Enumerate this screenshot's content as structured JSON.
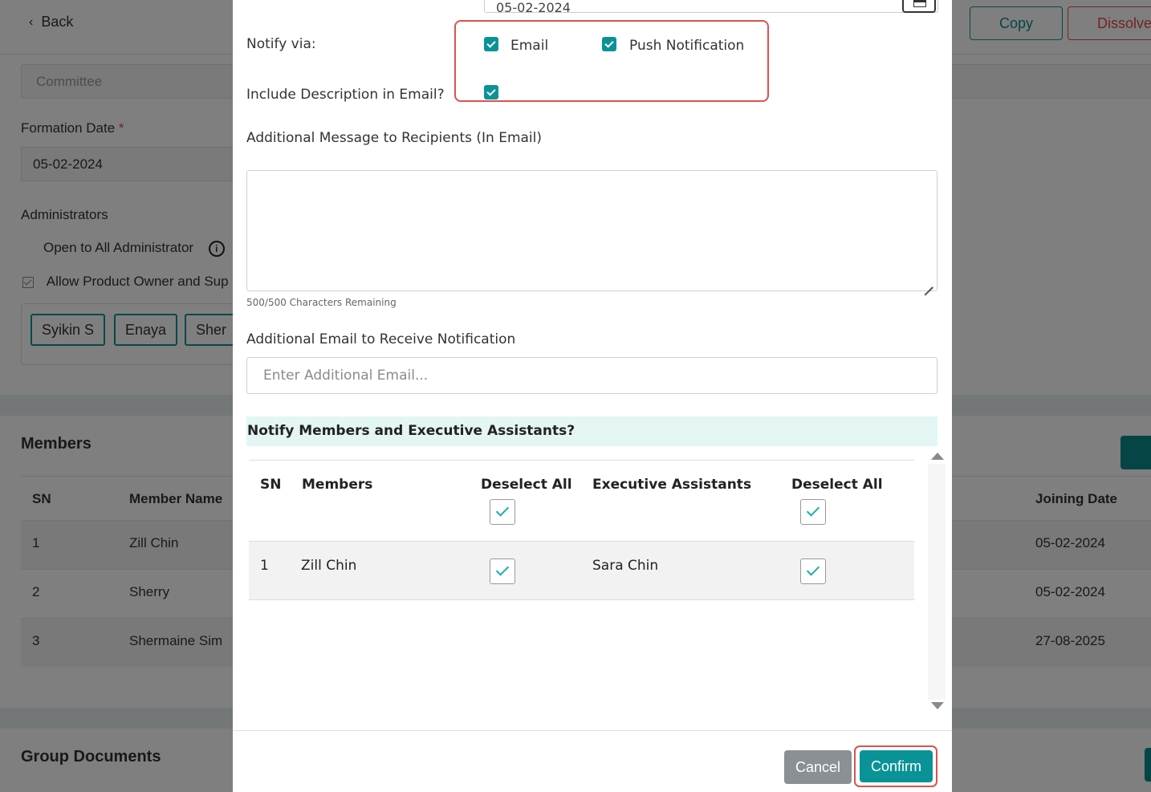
{
  "background": {
    "back_label": "Back",
    "copy_label": "Copy",
    "dissolve_label": "Dissolve",
    "committee_placeholder": "Committee",
    "formation_date_label": "Formation Date",
    "required_mark": "*",
    "formation_date_value": "05-02-2024",
    "administrators_label": "Administrators",
    "open_to_all_label": "Open to All Administrator",
    "allow_owner_label": "Allow Product Owner and Sup",
    "admin_chips": [
      "Syikin S",
      "Enaya",
      "Sher"
    ],
    "members_title": "Members",
    "members_columns": {
      "sn": "SN",
      "member_name": "Member Name",
      "joining_date": "Joining Date"
    },
    "members_rows": [
      {
        "sn": "1",
        "name": "Zill Chin",
        "joining": "05-02-2024"
      },
      {
        "sn": "2",
        "name": "Sherry",
        "joining": "05-02-2024"
      },
      {
        "sn": "3",
        "name": "Shermaine Sim",
        "joining": "27-08-2025"
      }
    ],
    "group_documents_title": "Group Documents"
  },
  "modal": {
    "date_value": "05-02-2024",
    "notify_via_label": "Notify via:",
    "email_label": "Email",
    "email_checked": true,
    "push_label": "Push Notification",
    "push_checked": true,
    "include_desc_label": "Include Description in Email?",
    "include_desc_checked": true,
    "additional_message_label": "Additional Message to Recipients (In Email)",
    "additional_message_value": "",
    "char_remaining": "500/500 Characters Remaining",
    "additional_email_label": "Additional Email to Receive Notification",
    "additional_email_placeholder": "Enter Additional Email...",
    "notify_members_title": "Notify Members and Executive Assistants?",
    "table": {
      "col_sn": "SN",
      "col_members": "Members",
      "col_deselect_members": "Deselect All",
      "col_exec": "Executive Assistants",
      "col_deselect_exec": "Deselect All",
      "rows": [
        {
          "sn": "1",
          "member": "Zill Chin",
          "member_checked": true,
          "exec": "Sara Chin",
          "exec_checked": true
        }
      ]
    },
    "cancel_label": "Cancel",
    "confirm_label": "Confirm"
  },
  "colors": {
    "accent": "#0a9396",
    "highlight": "#d9534f",
    "cancel": "#8a9094"
  }
}
